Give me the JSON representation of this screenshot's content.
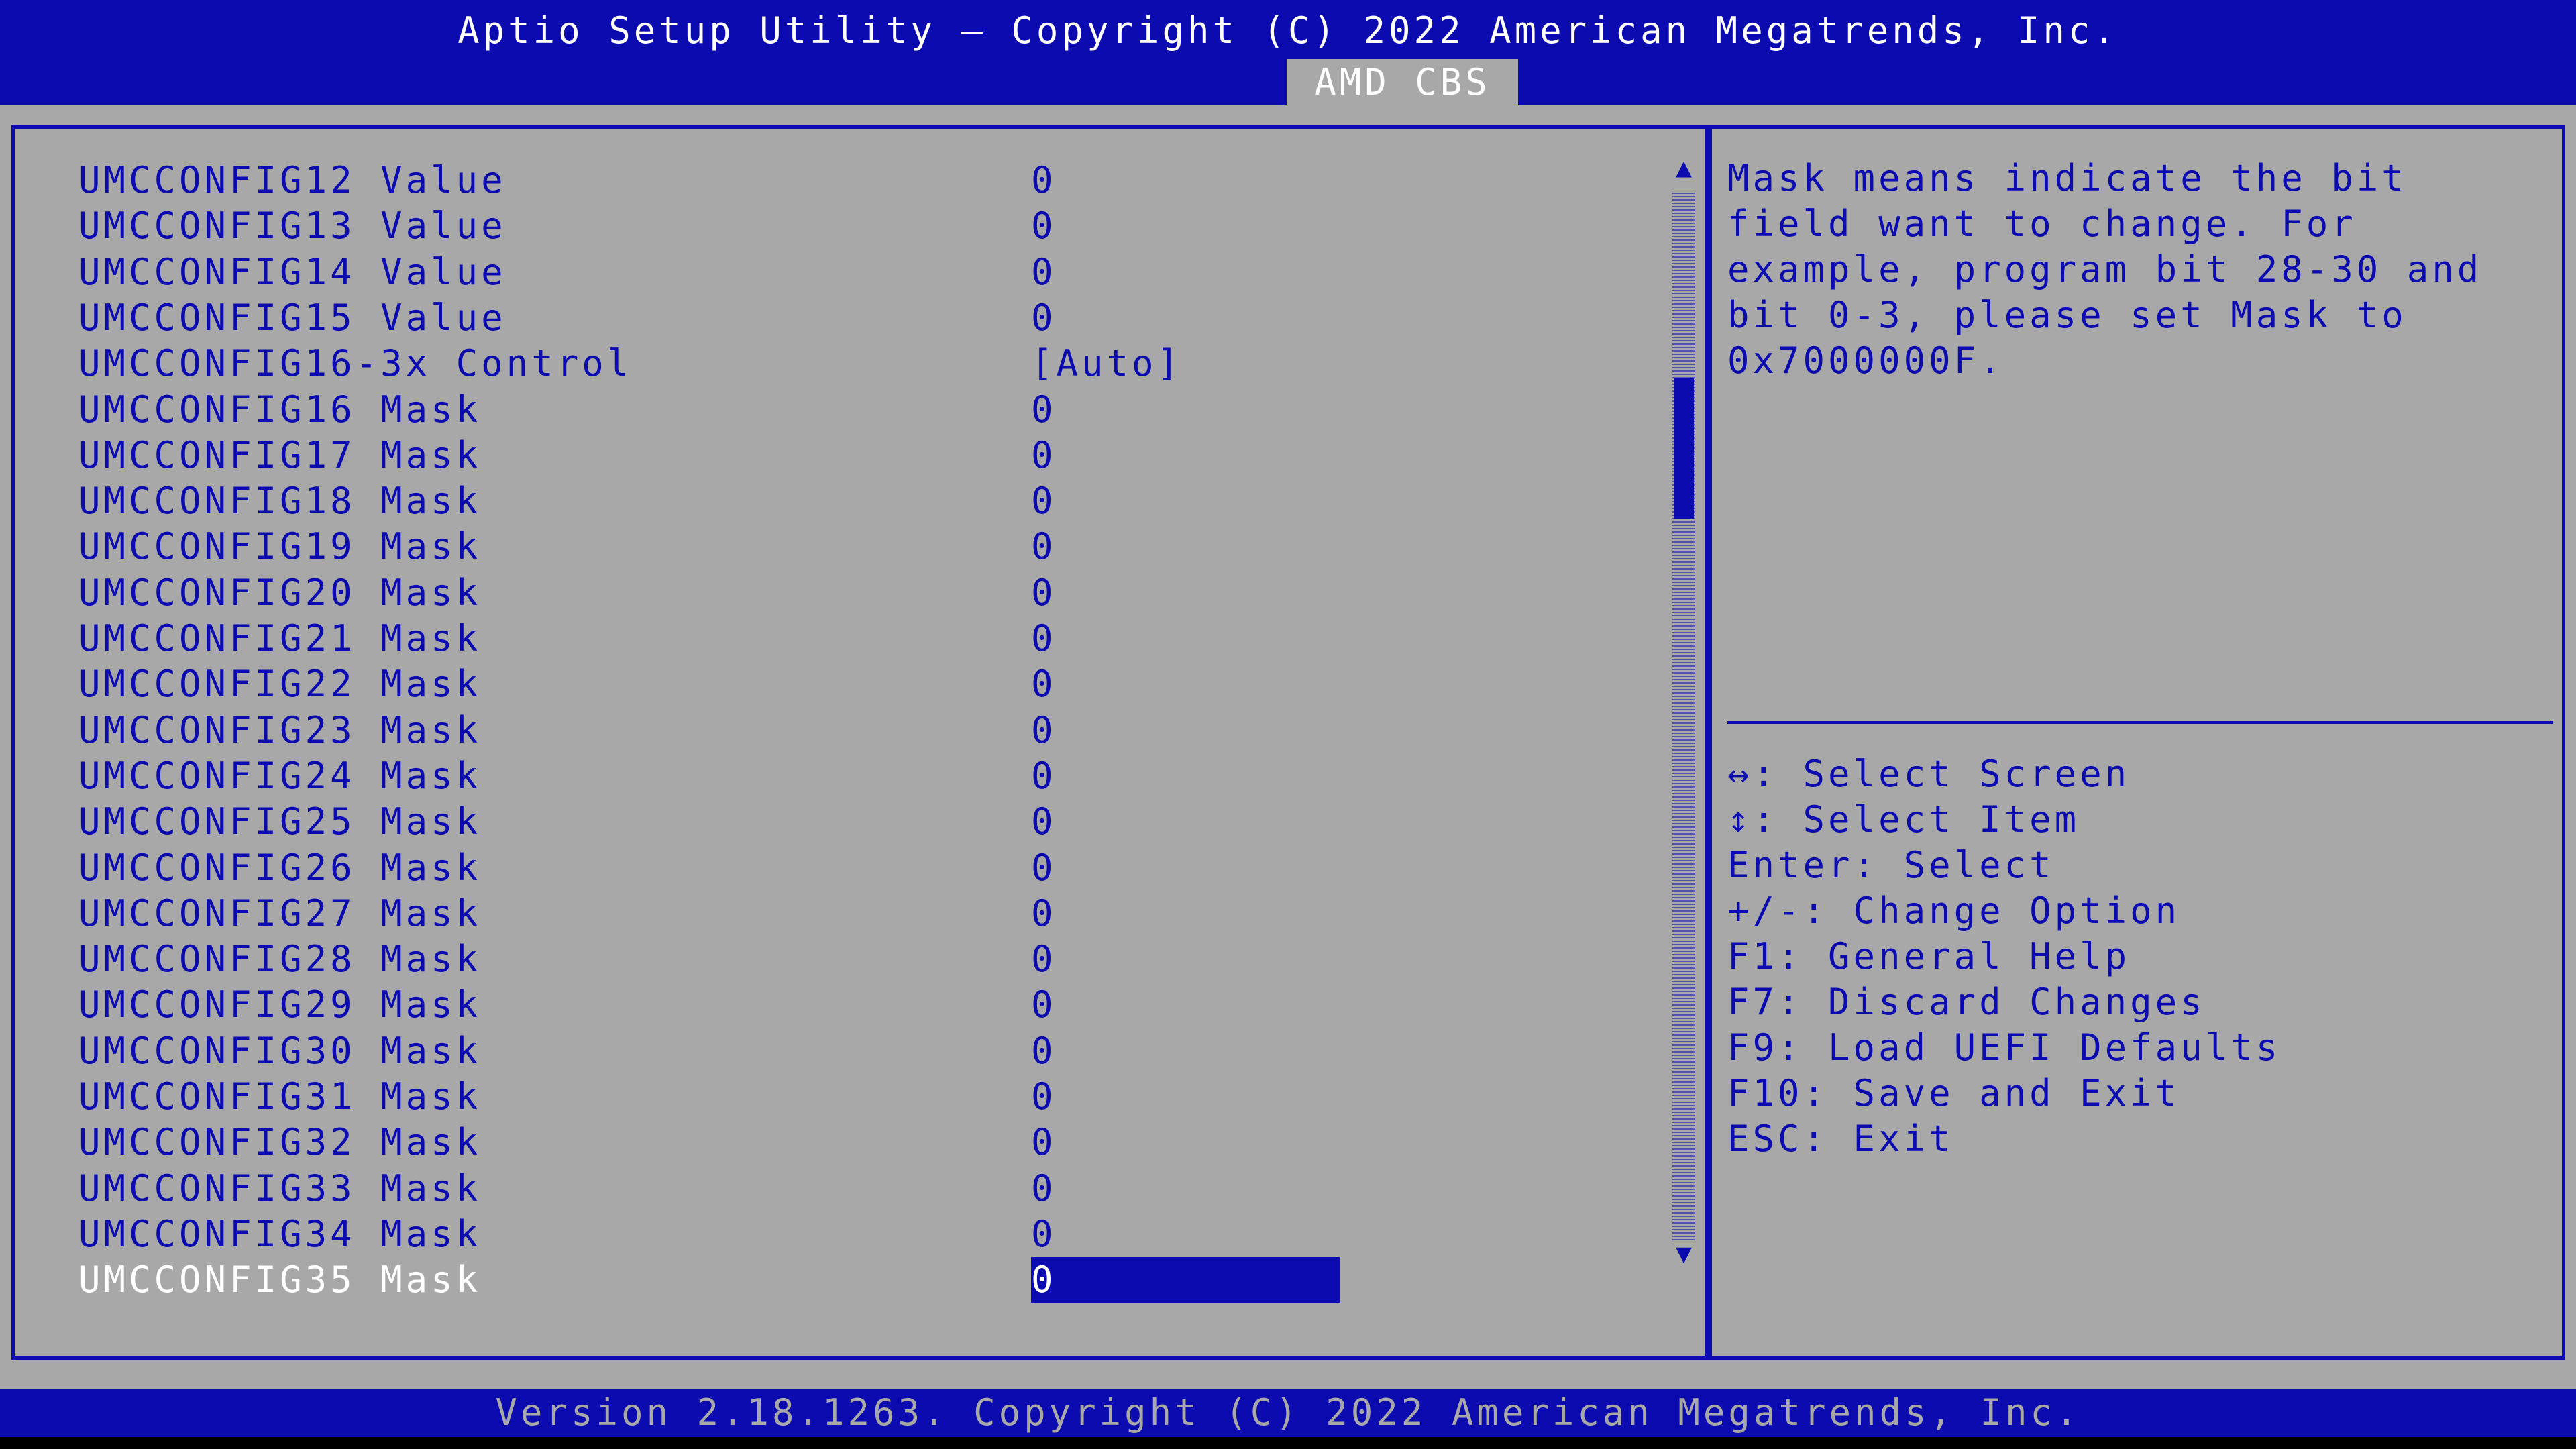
{
  "header": {
    "title": "Aptio Setup Utility – Copyright (C) 2022 American Megatrends, Inc.",
    "tab": "AMD CBS"
  },
  "settings": [
    {
      "label": "UMCCONFIG12 Value",
      "value": "0"
    },
    {
      "label": "UMCCONFIG13 Value",
      "value": "0"
    },
    {
      "label": "UMCCONFIG14 Value",
      "value": "0"
    },
    {
      "label": "UMCCONFIG15 Value",
      "value": "0"
    },
    {
      "label": "UMCCONFIG16-3x Control",
      "value": "[Auto]"
    },
    {
      "label": "UMCCONFIG16 Mask",
      "value": "0"
    },
    {
      "label": "UMCCONFIG17 Mask",
      "value": "0"
    },
    {
      "label": "UMCCONFIG18 Mask",
      "value": "0"
    },
    {
      "label": "UMCCONFIG19 Mask",
      "value": "0"
    },
    {
      "label": "UMCCONFIG20 Mask",
      "value": "0"
    },
    {
      "label": "UMCCONFIG21 Mask",
      "value": "0"
    },
    {
      "label": "UMCCONFIG22 Mask",
      "value": "0"
    },
    {
      "label": "UMCCONFIG23 Mask",
      "value": "0"
    },
    {
      "label": "UMCCONFIG24 Mask",
      "value": "0"
    },
    {
      "label": "UMCCONFIG25 Mask",
      "value": "0"
    },
    {
      "label": "UMCCONFIG26 Mask",
      "value": "0"
    },
    {
      "label": "UMCCONFIG27 Mask",
      "value": "0"
    },
    {
      "label": "UMCCONFIG28 Mask",
      "value": "0"
    },
    {
      "label": "UMCCONFIG29 Mask",
      "value": "0"
    },
    {
      "label": "UMCCONFIG30 Mask",
      "value": "0"
    },
    {
      "label": "UMCCONFIG31 Mask",
      "value": "0"
    },
    {
      "label": "UMCCONFIG32 Mask",
      "value": "0"
    },
    {
      "label": "UMCCONFIG33 Mask",
      "value": "0"
    },
    {
      "label": "UMCCONFIG34 Mask",
      "value": "0"
    },
    {
      "label": "UMCCONFIG35 Mask",
      "value": "0",
      "selected": true
    }
  ],
  "help": {
    "text": "Mask means indicate the bit\nfield want to change. For\nexample, program bit 28-30 and\nbit 0-3, please set Mask to\n0x7000000F."
  },
  "keys": [
    "↔: Select Screen",
    "↕: Select Item",
    "Enter: Select",
    "+/-: Change Option",
    "F1: General Help",
    "F7: Discard Changes",
    "F9: Load UEFI Defaults",
    "F10: Save and Exit",
    "ESC: Exit"
  ],
  "scrollbar": {
    "up_icon": "triangle-up",
    "down_icon": "triangle-down"
  },
  "footer": {
    "text": "Version 2.18.1263. Copyright (C) 2022 American Megatrends, Inc."
  },
  "colors": {
    "blue": "#0b0bb0",
    "gray": "#a8a8a8",
    "white": "#ffffff"
  }
}
